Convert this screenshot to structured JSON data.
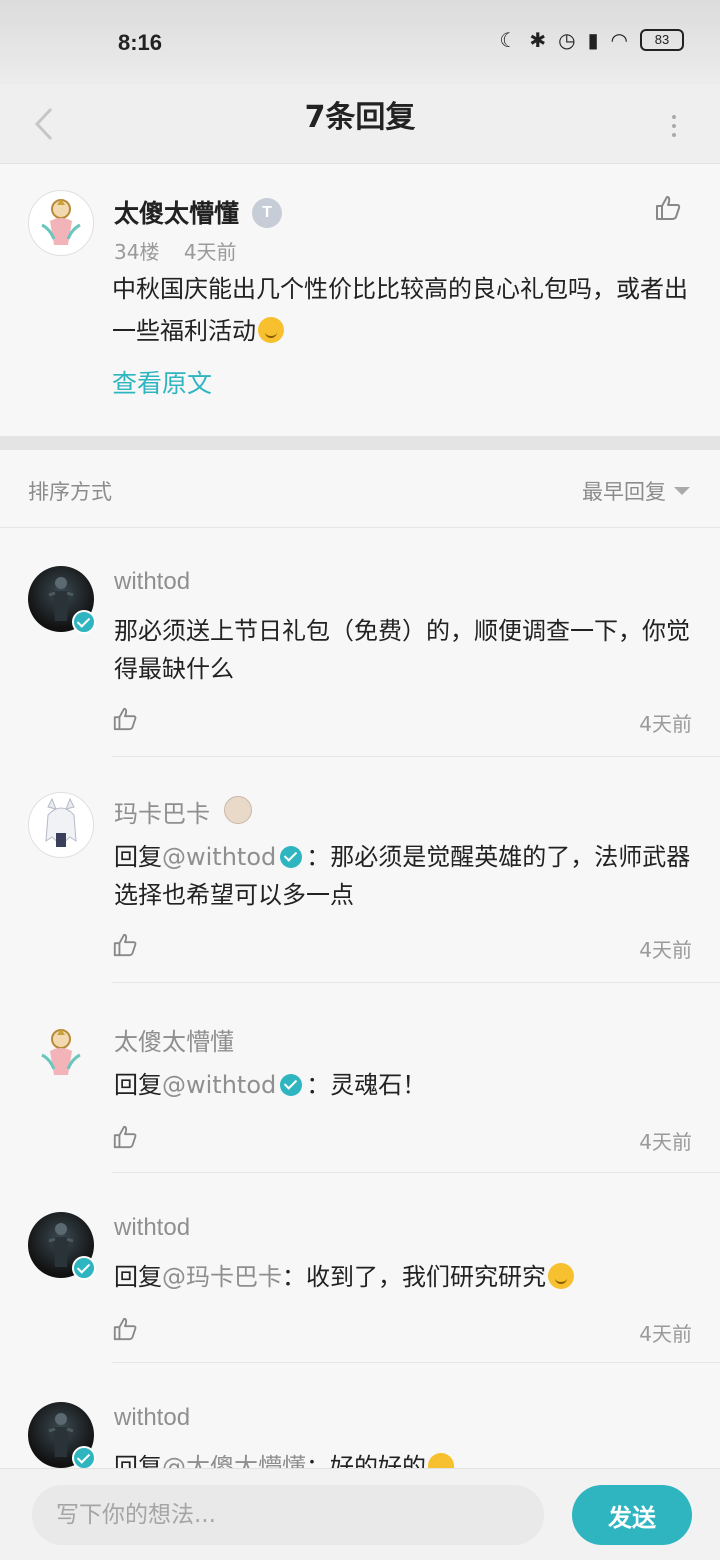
{
  "status_bar": {
    "time": "8:16",
    "battery": "83"
  },
  "nav": {
    "title": "7条回复"
  },
  "post": {
    "author": "太傻太懵懂",
    "level_badge": "T",
    "floor": "34楼",
    "time": "4天前",
    "body": "中秋国庆能出几个性价比比较高的良心礼包吗，或者出一些福利活动",
    "view_original": "查看原文"
  },
  "sort": {
    "label": "排序方式",
    "selected": "最早回复"
  },
  "replies": [
    {
      "author": "withtod",
      "text": "那必须送上节日礼包（免费）的，顺便调查一下，你觉得最缺什么",
      "time": "4天前"
    },
    {
      "author": "玛卡巴卡",
      "prefix": "回复",
      "mention": "@withtod",
      "text": "：那必须是觉醒英雄的了，法师武器选择也希望可以多一点",
      "time": "4天前"
    },
    {
      "author": "太傻太懵懂",
      "prefix": "回复",
      "mention": "@withtod",
      "text": "：灵魂石！",
      "time": "4天前"
    },
    {
      "author": "withtod",
      "prefix": "回复",
      "mention": "@玛卡巴卡",
      "text": "：收到了，我们研究研究",
      "time": "4天前"
    },
    {
      "author": "withtod",
      "prefix": "回复",
      "mention": "@太傻太懵懂",
      "text": "：好的好的",
      "time": ""
    }
  ],
  "composer": {
    "placeholder": "写下你的想法...",
    "send_label": "发送"
  },
  "colors": {
    "accent": "#2fb5c0",
    "text": "#222222",
    "muted": "#9a9a9a"
  }
}
